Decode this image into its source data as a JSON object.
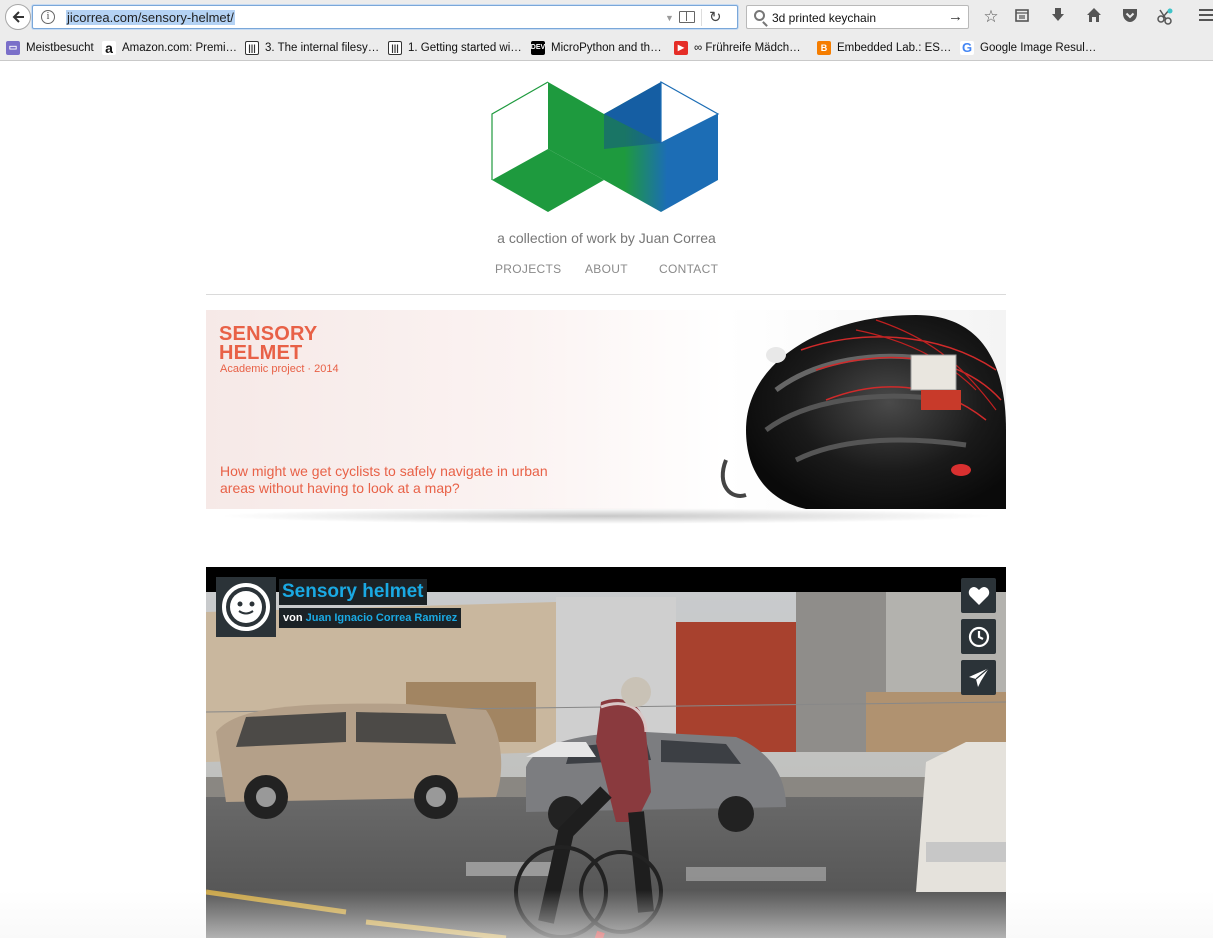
{
  "browser": {
    "url": "jicorrea.com/sensory-helmet/",
    "search_query": "3d printed keychain",
    "toolbar_icons": [
      "star-icon",
      "reading-list-icon",
      "download-icon",
      "home-icon",
      "pocket-icon",
      "extension-icon",
      "menu-icon"
    ]
  },
  "bookmarks": [
    {
      "label": "Meistbesucht",
      "icon": "folder-icon",
      "color": "#7a6fc9"
    },
    {
      "label": "Amazon.com: Premi…",
      "icon": "amazon-icon",
      "color": "#111111"
    },
    {
      "label": "3. The internal filesy…",
      "icon": "page-icon",
      "color": "#333333"
    },
    {
      "label": "1. Getting started wi…",
      "icon": "page-icon",
      "color": "#333333"
    },
    {
      "label": "MicroPython and th…",
      "icon": "dev-icon",
      "color": "#000000"
    },
    {
      "label": "∞ Frühreife Mädch…",
      "icon": "youtube-icon",
      "color": "#e52d27"
    },
    {
      "label": "Embedded Lab.: ES…",
      "icon": "blogger-icon",
      "color": "#f57d00"
    },
    {
      "label": "Google Image Resul…",
      "icon": "google-icon",
      "color": "#4285f4"
    }
  ],
  "site": {
    "tagline": "a collection of work by Juan Correa",
    "nav": [
      "PROJECTS",
      "ABOUT",
      "CONTACT"
    ],
    "logo_colors": {
      "green": "#1e9a3e",
      "blue": "#1c6db5"
    }
  },
  "hero": {
    "title_line1": "SENSORY",
    "title_line2": "HELMET",
    "subtitle": "Academic project  ·  2014",
    "question": "How might we get cyclists to safely navigate in urban areas without having to look at a map?",
    "accent": "#e86147"
  },
  "video": {
    "title": "Sensory helmet",
    "by_prefix": "von",
    "author": "Juan Ignacio Correa Ramirez",
    "buttons": [
      "like-icon",
      "watch-later-icon",
      "share-icon"
    ]
  }
}
